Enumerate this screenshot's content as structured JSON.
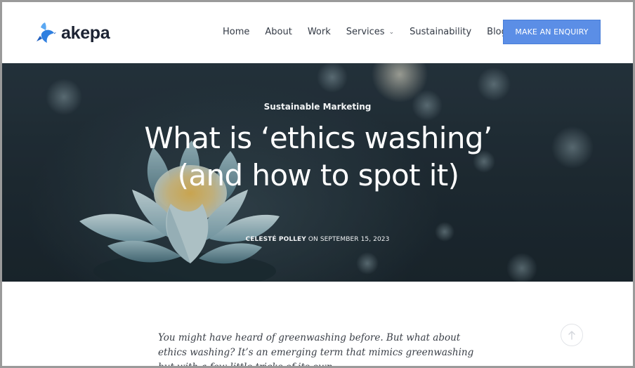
{
  "brand": {
    "name": "akepa",
    "logo_icon": "hummingbird-icon",
    "accent_color": "#2f7fe0"
  },
  "nav": {
    "items": [
      {
        "label": "Home"
      },
      {
        "label": "About"
      },
      {
        "label": "Work"
      },
      {
        "label": "Services",
        "has_dropdown": true
      },
      {
        "label": "Sustainability"
      },
      {
        "label": "Blog"
      }
    ],
    "cta_label": "MAKE AN ENQUIRY",
    "cta_color": "#5b8ee6"
  },
  "hero": {
    "category": "Sustainable Marketing",
    "title": "What is ‘ethics washing’ (and how to spot it)",
    "author": "CELESTÉ POLLEY",
    "date_text": "ON SEPTEMBER 15, 2023",
    "image": "water-lily-photo"
  },
  "article": {
    "intro": "You might have heard of greenwashing before. But what about ethics washing? It’s an emerging term that mimics greenwashing but with a few little tricks of its own."
  },
  "scroll_top": {
    "icon": "arrow-up-icon"
  }
}
